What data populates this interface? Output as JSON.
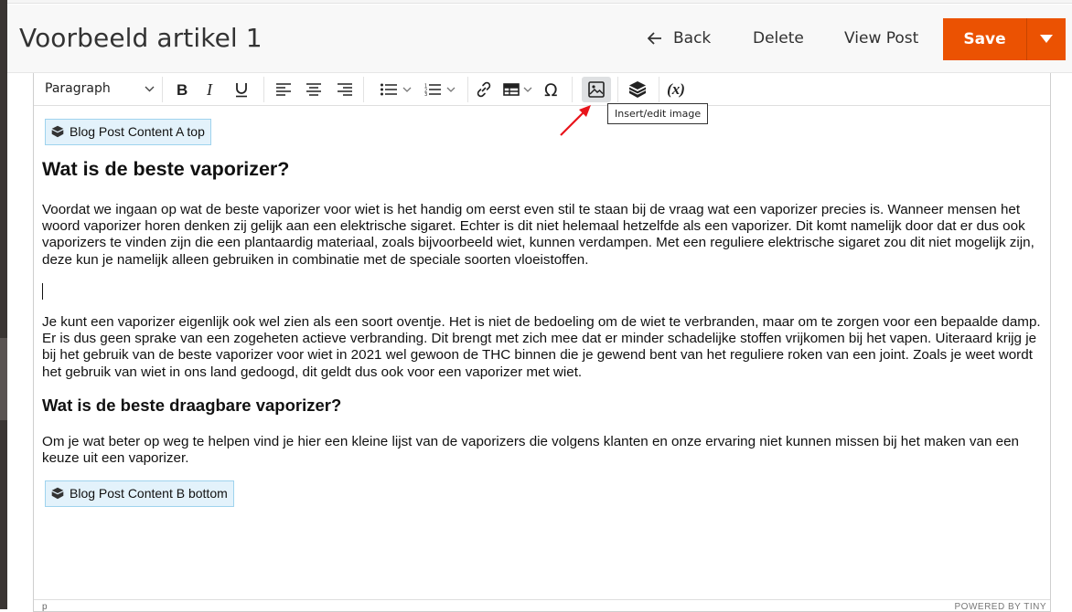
{
  "header": {
    "title": "Voorbeeld artikel 1",
    "back_label": "Back",
    "delete_label": "Delete",
    "view_post_label": "View Post",
    "save_label": "Save"
  },
  "toolbar": {
    "format_select_value": "Paragraph",
    "tooltip": "Insert/edit image",
    "variable_label": "(x)"
  },
  "content": {
    "widget_top": "Blog Post Content A top",
    "heading": "Wat is de beste vaporizer?",
    "paragraph1": "Voordat we ingaan op wat de beste vaporizer voor wiet is het handig om eerst even stil te staan bij de vraag wat een vaporizer precies is. Wanneer mensen het woord vaporizer horen denken zij gelijk aan een elektrische sigaret. Echter is dit niet helemaal hetzelfde als een vaporizer. Dit komt namelijk door dat er dus ook vaporizers te vinden zijn die een plantaardig materiaal, zoals bijvoorbeeld wiet, kunnen verdampen. Met een reguliere elektrische sigaret zou dit niet mogelijk zijn, deze kun je namelijk alleen gebruiken in combinatie met de speciale soorten vloeistoffen.",
    "paragraph2": "Je kunt een vaporizer eigenlijk ook wel zien als een soort oventje. Het is niet de bedoeling om de wiet te verbranden, maar om te zorgen voor een bepaalde damp. Er is dus geen sprake van een zogeheten actieve verbranding. Dit brengt met zich mee dat er minder schadelijke stoffen vrijkomen bij het vapen. Uiteraard krijg je bij het gebruik van de beste vaporizer voor wiet in 2021 wel gewoon de THC binnen die je gewend bent van het reguliere roken van een joint. Zoals je weet wordt het gebruik van wiet in ons land gedoogd, dit geldt dus ook voor een vaporizer met wiet.",
    "subheading": "Wat is de beste draagbare vaporizer?",
    "paragraph3": "Om je wat beter op weg te helpen vind je hier een kleine lijst van de vaporizers die volgens klanten en onze ervaring niet kunnen missen bij het maken van een keuze uit een vaporizer.",
    "widget_bottom": "Blog Post Content B bottom"
  },
  "status": {
    "path": "p",
    "brand": "POWERED BY TINY"
  },
  "colors": {
    "save": "#eb5202",
    "widget_bg": "#e3f2fb",
    "widget_border": "#9fd3ee",
    "arrow": "#e8141b"
  }
}
